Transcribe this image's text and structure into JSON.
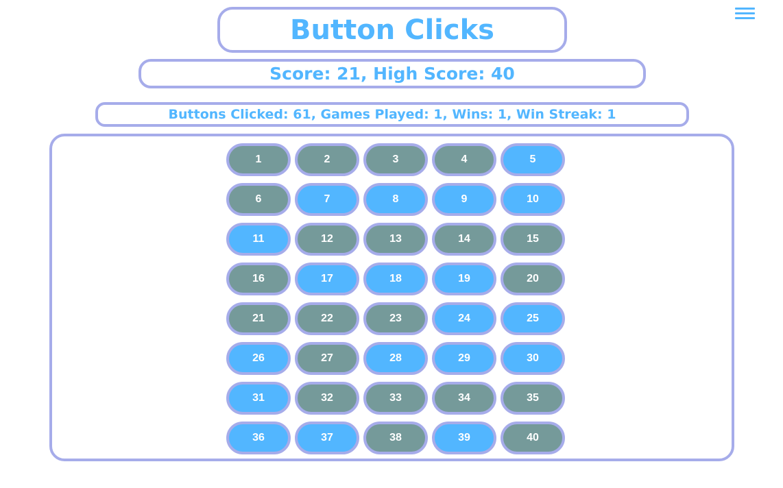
{
  "header": {
    "title": "Button Clicks",
    "score_text": "Score: 21, High Score: 40",
    "stats_text": "Buttons Clicked: 61, Games Played: 1, Wins: 1, Win Streak: 1",
    "menu_icon": "hamburger-menu-icon"
  },
  "colors": {
    "accent": "#52b6ff",
    "border": "#a6acea",
    "button_active": "#52b6ff",
    "button_inactive": "#759a9a"
  },
  "buttons": [
    {
      "label": "1",
      "active": false
    },
    {
      "label": "2",
      "active": false
    },
    {
      "label": "3",
      "active": false
    },
    {
      "label": "4",
      "active": false
    },
    {
      "label": "5",
      "active": true
    },
    {
      "label": "6",
      "active": false
    },
    {
      "label": "7",
      "active": true
    },
    {
      "label": "8",
      "active": true
    },
    {
      "label": "9",
      "active": true
    },
    {
      "label": "10",
      "active": true
    },
    {
      "label": "11",
      "active": true
    },
    {
      "label": "12",
      "active": false
    },
    {
      "label": "13",
      "active": false
    },
    {
      "label": "14",
      "active": false
    },
    {
      "label": "15",
      "active": false
    },
    {
      "label": "16",
      "active": false
    },
    {
      "label": "17",
      "active": true
    },
    {
      "label": "18",
      "active": true
    },
    {
      "label": "19",
      "active": true
    },
    {
      "label": "20",
      "active": false
    },
    {
      "label": "21",
      "active": false
    },
    {
      "label": "22",
      "active": false
    },
    {
      "label": "23",
      "active": false
    },
    {
      "label": "24",
      "active": true
    },
    {
      "label": "25",
      "active": true
    },
    {
      "label": "26",
      "active": true
    },
    {
      "label": "27",
      "active": false
    },
    {
      "label": "28",
      "active": true
    },
    {
      "label": "29",
      "active": true
    },
    {
      "label": "30",
      "active": true
    },
    {
      "label": "31",
      "active": true
    },
    {
      "label": "32",
      "active": false
    },
    {
      "label": "33",
      "active": false
    },
    {
      "label": "34",
      "active": false
    },
    {
      "label": "35",
      "active": false
    },
    {
      "label": "36",
      "active": true
    },
    {
      "label": "37",
      "active": true
    },
    {
      "label": "38",
      "active": false
    },
    {
      "label": "39",
      "active": true
    },
    {
      "label": "40",
      "active": false
    }
  ]
}
